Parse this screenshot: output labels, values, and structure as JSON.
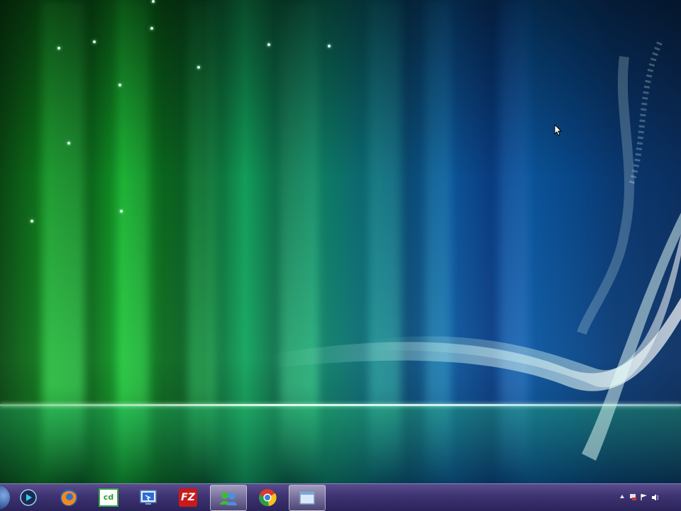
{
  "desktop": {
    "wallpaper": "windows-aurora",
    "colors": {
      "green": "#13a52a",
      "teal": "#0e7f6a",
      "blue": "#0d5aa0",
      "taskbar": "#3e3372"
    }
  },
  "taskbar": {
    "start": {
      "icon": "windows-start-orb-icon"
    },
    "apps": [
      {
        "name": "windows-media-player",
        "icon": "media-player-icon",
        "active": false
      },
      {
        "name": "firefox",
        "icon": "firefox-icon",
        "active": false
      },
      {
        "name": "cd-app",
        "icon": "cd-app-icon",
        "active": false
      },
      {
        "name": "remote-desktop",
        "icon": "remote-desktop-icon",
        "active": false
      },
      {
        "name": "filezilla",
        "icon": "filezilla-icon",
        "active": false
      },
      {
        "name": "messenger",
        "icon": "messenger-icon",
        "active": true
      },
      {
        "name": "chrome",
        "icon": "chrome-icon",
        "active": false
      },
      {
        "name": "window-app",
        "icon": "window-app-icon",
        "active": true
      }
    ],
    "filezilla_label": "FZ",
    "cd_label": "cd",
    "tray": {
      "icons": [
        "show-hidden-icons-arrow",
        "network-icon",
        "flag-icon",
        "volume-icon"
      ]
    }
  }
}
